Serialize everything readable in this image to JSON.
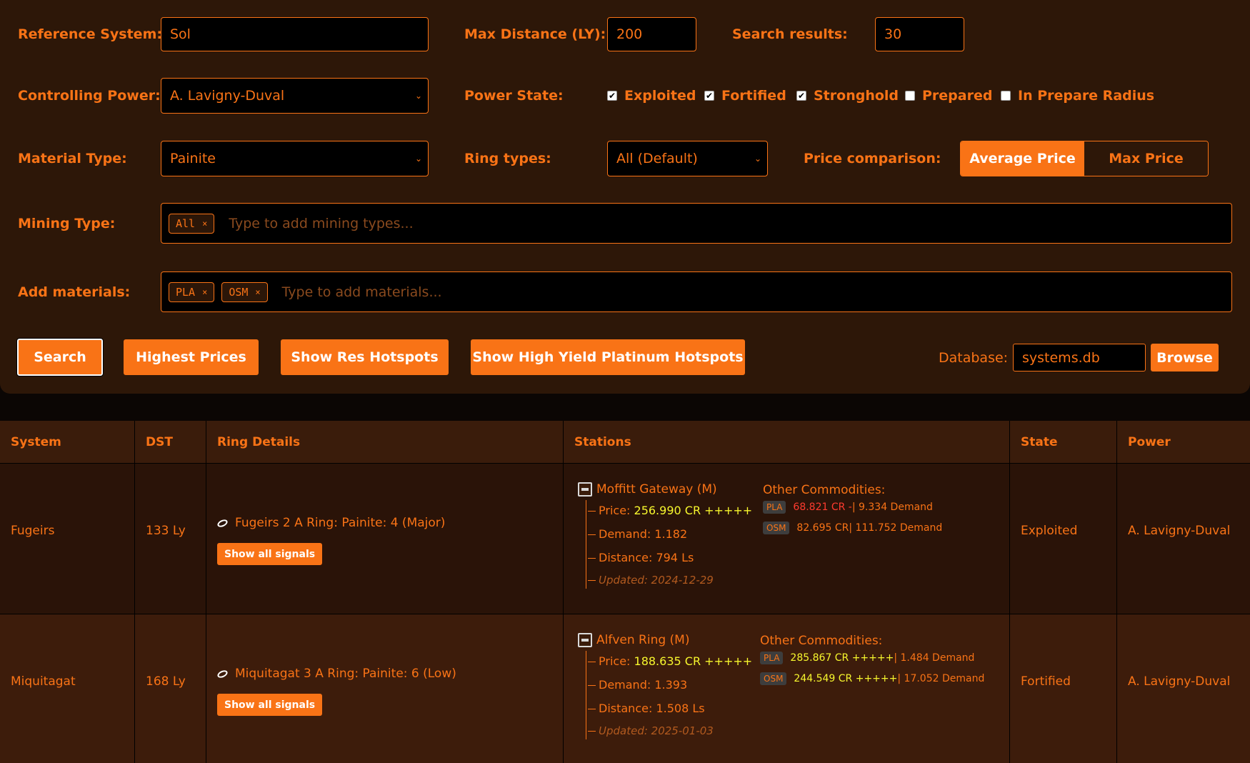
{
  "form": {
    "reference_system": {
      "label": "Reference System:",
      "value": "Sol"
    },
    "max_distance": {
      "label": "Max Distance (LY):",
      "value": "200"
    },
    "search_results": {
      "label": "Search results:",
      "value": "30"
    },
    "controlling_power": {
      "label": "Controlling Power:",
      "value": "A. Lavigny-Duval"
    },
    "power_state": {
      "label": "Power State:",
      "options": [
        {
          "label": "Exploited",
          "checked": true
        },
        {
          "label": "Fortified",
          "checked": true
        },
        {
          "label": "Stronghold",
          "checked": true
        },
        {
          "label": "Prepared",
          "checked": false
        },
        {
          "label": "In Prepare Radius",
          "checked": false
        }
      ]
    },
    "material_type": {
      "label": "Material Type:",
      "value": "Painite"
    },
    "ring_types": {
      "label": "Ring types:",
      "value": "All (Default)"
    },
    "price_comparison": {
      "label": "Price comparison:",
      "options": [
        "Average Price",
        "Max Price"
      ],
      "selected": "Average Price"
    },
    "mining_type": {
      "label": "Mining Type:",
      "tags": [
        "All"
      ],
      "placeholder": "Type to add mining types..."
    },
    "add_materials": {
      "label": "Add materials:",
      "tags": [
        "PLA",
        "OSM"
      ],
      "placeholder": "Type to add materials..."
    },
    "tag_remove_glyph": "×"
  },
  "actions": {
    "search": "Search",
    "highest_prices": "Highest Prices",
    "show_res_hotspots": "Show Res Hotspots",
    "show_high_yield": "Show High Yield Platinum Hotspots",
    "database_label": "Database:",
    "database_value": "systems.db",
    "browse": "Browse"
  },
  "table": {
    "headers": [
      "System",
      "DST",
      "Ring Details",
      "Stations",
      "State",
      "Power"
    ],
    "rows": [
      {
        "system": "Fugeirs",
        "dst": "133 Ly",
        "ring": "Fugeirs 2 A Ring: Painite: 4 (Major)",
        "signals_button": "Show all signals",
        "station": {
          "name": "Moffitt Gateway (M)",
          "price_label": "Price: ",
          "price_value": "256.990 CR +++++",
          "demand": "Demand: 1.182",
          "distance": "Distance: 794 Ls",
          "updated": "Updated: 2024-12-29"
        },
        "other_title": "Other Commodities:",
        "other": [
          {
            "code": "PLA",
            "price": "68.821 CR -",
            "demand": " | 9.334 Demand",
            "low": true
          },
          {
            "code": "OSM",
            "price": "82.695 CR",
            "demand": " | 111.752 Demand",
            "low": false
          }
        ],
        "state": "Exploited",
        "power": "A. Lavigny-Duval"
      },
      {
        "system": "Miquitagat",
        "dst": "168 Ly",
        "ring": "Miquitagat 3 A Ring: Painite: 6 (Low)",
        "signals_button": "Show all signals",
        "station": {
          "name": "Alfven Ring (M)",
          "price_label": "Price: ",
          "price_value": "188.635 CR +++++",
          "demand": "Demand: 1.393",
          "distance": "Distance: 1.508 Ls",
          "updated": "Updated: 2025-01-03"
        },
        "other_title": "Other Commodities:",
        "other": [
          {
            "code": "PLA",
            "price": "285.867 CR +++++",
            "demand": " | 1.484 Demand",
            "low": false,
            "high": true
          },
          {
            "code": "OSM",
            "price": "244.549 CR +++++",
            "demand": " | 17.052 Demand",
            "low": false,
            "high": true
          }
        ],
        "state": "Fortified",
        "power": "A. Lavigny-Duval"
      }
    ]
  }
}
